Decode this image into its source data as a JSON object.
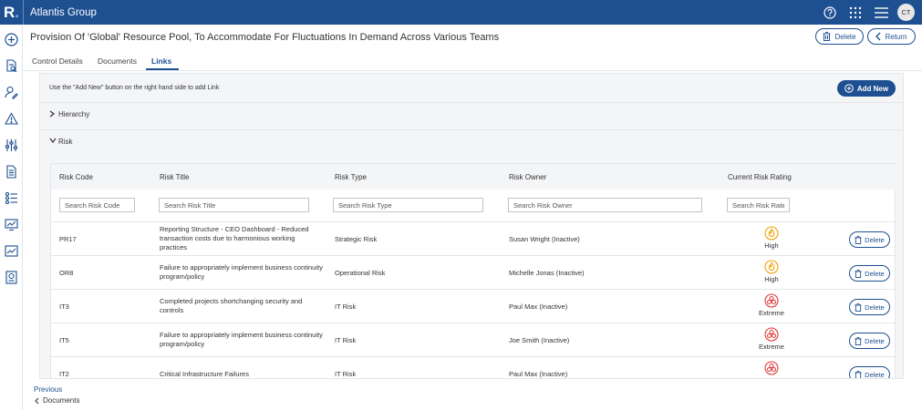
{
  "app": {
    "logo_letter": "R",
    "logo_dot": ".",
    "name": "Atlantis Group",
    "user_initials": "CT"
  },
  "page": {
    "title": "Provision Of 'Global' Resource Pool, To Accommodate For Fluctuations In Demand Across Various Teams"
  },
  "header_actions": {
    "delete_label": "Delete",
    "return_label": "Return"
  },
  "tabs": [
    {
      "label": "Control Details"
    },
    {
      "label": "Documents"
    },
    {
      "label": "Links",
      "active": true
    }
  ],
  "links": {
    "info_text": "Use the \"Add New\" button on the right hand side to add Link",
    "add_new_label": "Add New",
    "sections": [
      {
        "label": "Hierarchy",
        "expanded": false
      },
      {
        "label": "Risk",
        "expanded": true
      }
    ]
  },
  "risk_table": {
    "columns": [
      "Risk Code",
      "Risk Title",
      "Risk Type",
      "Risk Owner",
      "Current Risk Rating"
    ],
    "filters": [
      "Search Risk Code",
      "Search Risk Title",
      "Search Risk Type",
      "Search Risk Owner",
      "Search Risk Ratin"
    ],
    "delete_label": "Delete",
    "rows": [
      {
        "code": "PR17",
        "title": "Reporting Structure - CEO Dashboard - Reduced transaction costs due to harmonious working practices",
        "type": "Strategic Risk",
        "owner": "Susan Wright (Inactive)",
        "rating": "High"
      },
      {
        "code": "OR8",
        "title": "Failure to appropriately implement business continuity program/policy",
        "type": "Operational Risk",
        "owner": "Michelle Jonas (Inactive)",
        "rating": "High"
      },
      {
        "code": "IT3",
        "title": "Completed projects shortchanging security and controls",
        "type": "IT Risk",
        "owner": "Paul Max (Inactive)",
        "rating": "Extreme"
      },
      {
        "code": "IT5",
        "title": "Failure to appropriately implement business continuity program/policy",
        "type": "IT Risk",
        "owner": "Joe Smith (Inactive)",
        "rating": "Extreme"
      },
      {
        "code": "IT2",
        "title": "Critical Infrastructure Failures",
        "type": "IT Risk",
        "owner": "Paul Max (Inactive)",
        "rating": ""
      }
    ]
  },
  "footer": {
    "previous_label": "Previous",
    "previous_link": "Documents"
  },
  "colors": {
    "brand": "#1d4f91",
    "high": "#f0a30a",
    "extreme": "#e03c3c"
  },
  "icons": {
    "rail": [
      "plus-circle-icon",
      "document-search-icon",
      "user-edit-icon",
      "warning-icon",
      "sliders-icon",
      "document-list-icon",
      "checklist-icon",
      "monitor-icon",
      "chart-icon",
      "report-icon"
    ],
    "top": [
      "help-icon",
      "apps-grid-icon",
      "hamburger-menu-icon"
    ]
  }
}
